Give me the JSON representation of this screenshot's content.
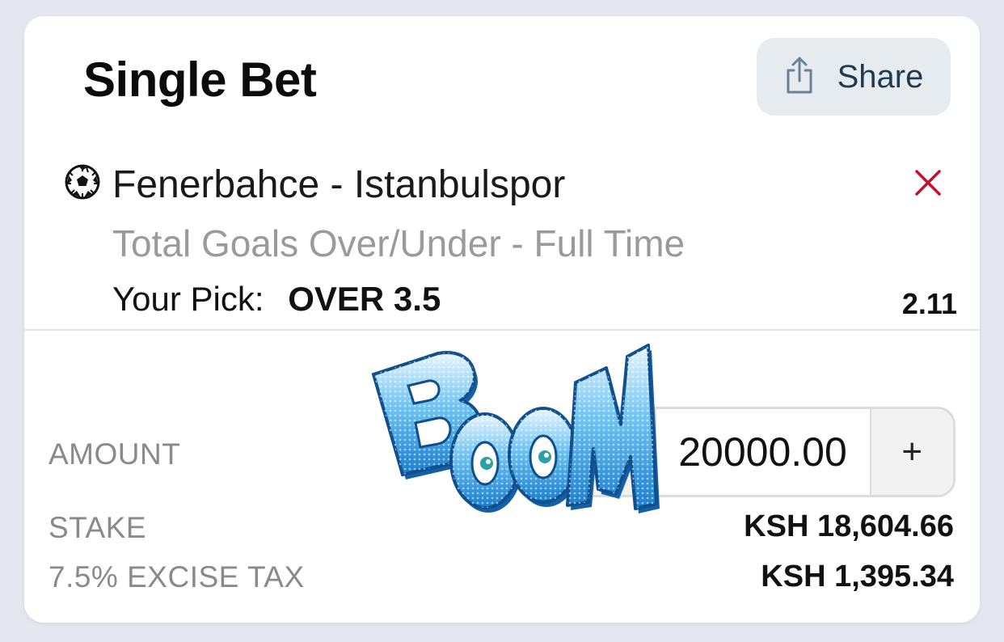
{
  "header": {
    "title": "Single Bet",
    "share_label": "Share",
    "share_icon": "share-icon"
  },
  "selection": {
    "sport_icon": "soccer-ball-icon",
    "match": "Fenerbahce - Istanbulspor",
    "market": "Total Goals Over/Under - Full Time",
    "pick_label": "Your Pick:",
    "pick_value": "OVER 3.5",
    "odds": "2.11",
    "remove_icon": "close-icon",
    "remove_color": "#c8102e"
  },
  "amount": {
    "label": "AMOUNT",
    "value": "20000.00",
    "minus_label": "",
    "plus_label": "+"
  },
  "summary": {
    "stake_label": "STAKE",
    "stake_value": "KSH 18,604.66",
    "tax_label": "7.5% EXCISE TAX",
    "tax_value": "KSH 1,395.34"
  },
  "overlay": {
    "sticker_text": "BOOM",
    "sticker_icon": "boom-sticker-icon"
  },
  "colors": {
    "background": "#e4e7ef",
    "card": "#ffffff",
    "share_button_bg": "#e6ebef",
    "share_text": "#1f3b52",
    "muted_text": "#8a8a8a",
    "sticker_blue": "#2f8fd6"
  }
}
